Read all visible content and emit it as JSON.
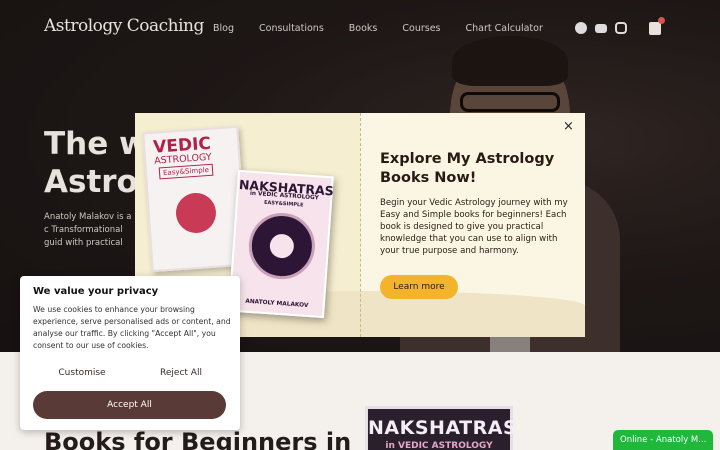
{
  "site": {
    "logo": "Astrology Coaching"
  },
  "nav": {
    "items": [
      "Blog",
      "Consultations",
      "Books",
      "Courses",
      "Chart Calculator"
    ]
  },
  "hero": {
    "title_line1": "The w",
    "title_line2": "Astro",
    "description": "Anatoly Malakov is a c Transformational guid with practical spiritu"
  },
  "modal": {
    "title": "Explore My Astrology Books Now!",
    "text": "Begin your Vedic Astrology journey with my Easy and Simple books for beginners! Each book is designed to give you practical knowledge that you can use to align with your true purpose and harmony.",
    "button_label": "Learn more",
    "close_label": "×",
    "book1": {
      "title_a": "VEDIC",
      "title_b": "ASTROLOGY",
      "tag": "Easy&Simple"
    },
    "book2": {
      "title": "NAKSHATRAS",
      "subtitle": "in VEDIC ASTROLOGY",
      "tag": "EASY&SIMPLE",
      "author": "ANATOLY MALAKOV"
    }
  },
  "cookie": {
    "title": "We value your privacy",
    "text": "We use cookies to enhance your browsing experience, serve personalised ads or content, and analyse our traffic. By clicking \"Accept All\", you consent to our use of cookies.",
    "customise_label": "Customise",
    "reject_label": "Reject All",
    "accept_label": "Accept All"
  },
  "section": {
    "title": "Books for Beginners in",
    "book_title": "NAKSHATRAS",
    "book_subtitle": "in VEDIC ASTROLOGY"
  },
  "chat": {
    "label": "Online - Anatoly M..."
  },
  "colors": {
    "accent": "#f3b42c",
    "brand_dark": "#5a3a36",
    "chat_green": "#1fb83a"
  }
}
